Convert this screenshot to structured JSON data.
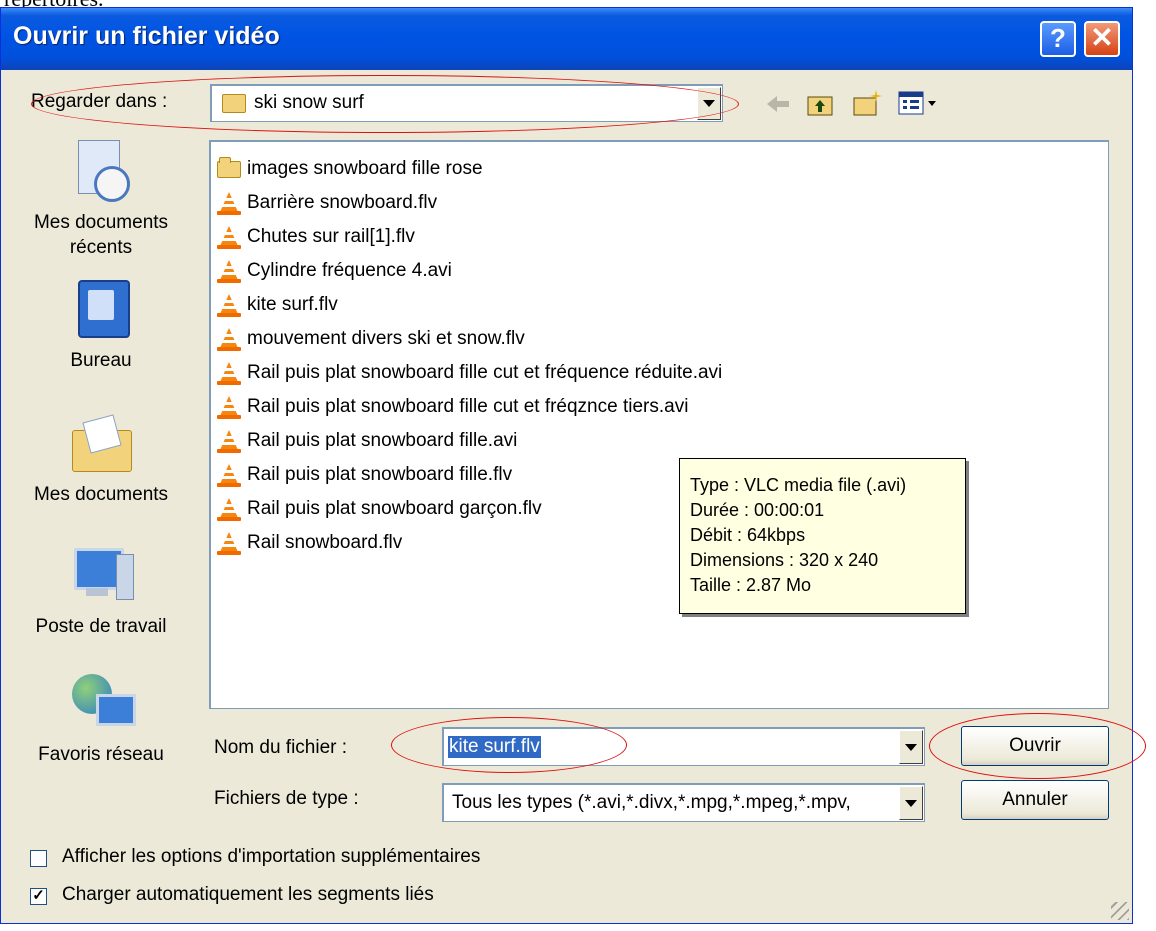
{
  "background_text": "répertoires.",
  "window": {
    "title": "Ouvrir un fichier vidéo",
    "help_glyph": "?",
    "close_glyph": "✕"
  },
  "look_in": {
    "label": "Regarder dans :",
    "value": "ski snow surf"
  },
  "places": [
    {
      "label": "Mes documents récents",
      "icon": "recent-documents-icon"
    },
    {
      "label": "Bureau",
      "icon": "desktop-icon"
    },
    {
      "label": "Mes documents",
      "icon": "my-documents-icon"
    },
    {
      "label": "Poste de travail",
      "icon": "my-computer-icon"
    },
    {
      "label": "Favoris réseau",
      "icon": "network-places-icon"
    }
  ],
  "files": [
    {
      "name": "images snowboard fille rose",
      "type": "folder"
    },
    {
      "name": "Barrière snowboard.flv",
      "type": "vlc"
    },
    {
      "name": "Chutes sur rail[1].flv",
      "type": "vlc"
    },
    {
      "name": "Cylindre fréquence 4.avi",
      "type": "vlc"
    },
    {
      "name": "kite surf.flv",
      "type": "vlc"
    },
    {
      "name": "mouvement divers ski et snow.flv",
      "type": "vlc"
    },
    {
      "name": "Rail puis plat snowboard fille cut et fréquence réduite.avi",
      "type": "vlc"
    },
    {
      "name": "Rail puis plat snowboard fille cut et fréqznce tiers.avi",
      "type": "vlc"
    },
    {
      "name": "Rail puis plat snowboard fille.avi",
      "type": "vlc"
    },
    {
      "name": "Rail puis plat snowboard fille.flv",
      "type": "vlc"
    },
    {
      "name": "Rail puis plat snowboard garçon.flv",
      "type": "vlc"
    },
    {
      "name": "Rail snowboard.flv",
      "type": "vlc"
    }
  ],
  "tooltip": {
    "type": "Type : VLC media file (.avi)",
    "duration": "Durée : 00:00:01",
    "bitrate": "Débit : 64kbps",
    "dimensions": "Dimensions : 320 x 240",
    "size": "Taille  : 2.87 Mo"
  },
  "filename": {
    "label": "Nom du fichier :",
    "value": "kite surf.flv"
  },
  "filetype": {
    "label": "Fichiers de type :",
    "value": "Tous les types (*.avi,*.divx,*.mpg,*.mpeg,*.mpv,"
  },
  "buttons": {
    "open": "Ouvrir",
    "cancel": "Annuler"
  },
  "options": {
    "import_options": {
      "label": "Afficher les options d'importation supplémentaires",
      "checked": false
    },
    "auto_load": {
      "label": "Charger automatiquement les segments liés",
      "checked": true,
      "check_glyph": "✓"
    }
  },
  "colors": {
    "titlebar": "#0054e3",
    "dialog_bg": "#ece9d8",
    "highlight": "#316ac5",
    "annotation": "#e01010",
    "tooltip_bg": "#ffffe1"
  }
}
